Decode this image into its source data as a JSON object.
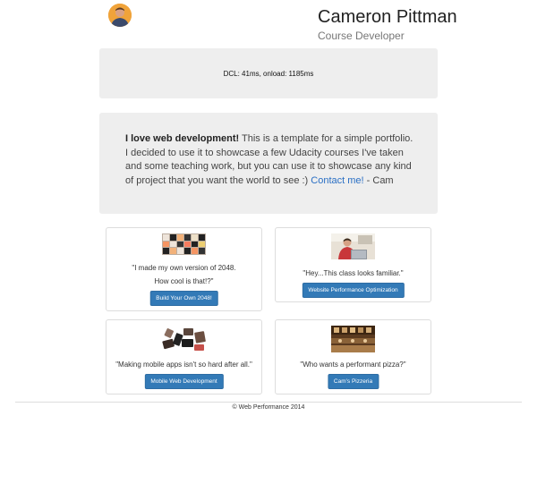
{
  "header": {
    "name": "Cameron Pittman",
    "role": "Course Developer"
  },
  "perf": {
    "text": "DCL: 41ms, onload: 1185ms"
  },
  "intro": {
    "strong": "I love web development!",
    "body": " This is a template for a simple portfolio. I decided to use it to showcase a few Udacity courses I've taken and some teaching work, but you can use it to showcase any kind of project that you want the world to see :) ",
    "link": "Contact me!",
    "sign": " - Cam"
  },
  "projects": [
    {
      "quote": "\"I made my own version of 2048.\nHow cool is that!?\"",
      "button": "Build Your Own 2048!",
      "thumb": "2048-thumbnail"
    },
    {
      "quote": "\"Hey...This class looks familiar.\"",
      "button": "Website Performance Optimization",
      "thumb": "person-laptop-thumbnail"
    },
    {
      "quote": "\"Making mobile apps isn't so hard after all.\"",
      "button": "Mobile Web Development",
      "thumb": "mobile-devices-thumbnail"
    },
    {
      "quote": "\"Who wants a performant pizza?\"",
      "button": "Cam's Pizzeria",
      "thumb": "pizzeria-thumbnail"
    }
  ],
  "footer": {
    "text": "© Web Performance 2014"
  },
  "colors": {
    "button": "#337ab7",
    "link": "#2a6fc4",
    "panel": "#eeeeee"
  }
}
